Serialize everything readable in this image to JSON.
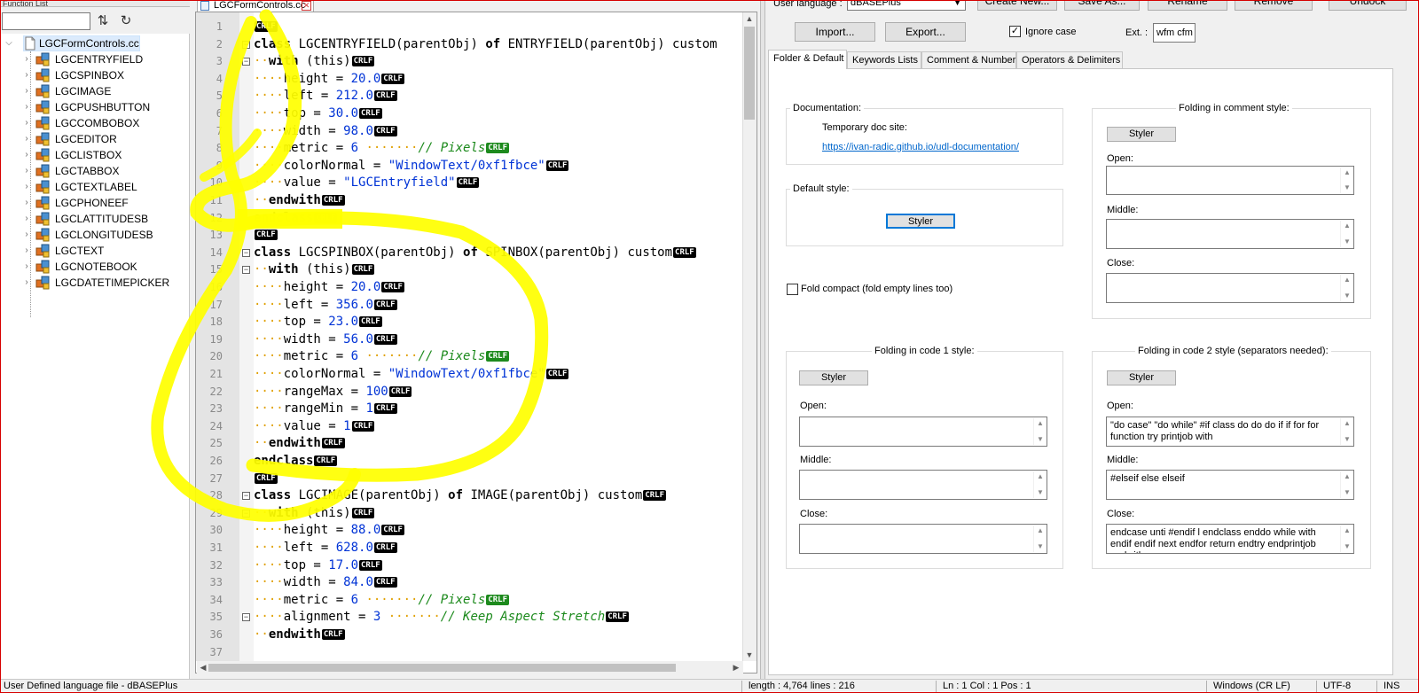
{
  "function_list": {
    "title": "Function List",
    "search_value": "",
    "sort_icon": "sort-az-icon",
    "refresh_icon": "refresh-icon",
    "root": "LGCFormControls.cc",
    "items": [
      "LGCENTRYFIELD",
      "LGCSPINBOX",
      "LGCIMAGE",
      "LGCPUSHBUTTON",
      "LGCCOMBOBOX",
      "LGCEDITOR",
      "LGCLISTBOX",
      "LGCTABBOX",
      "LGCTEXTLABEL",
      "LGCPHONEEF",
      "LGCLATTITUDESB",
      "LGCLONGITUDESB",
      "LGCTEXT",
      "LGCNOTEBOOK",
      "LGCDATETIMEPICKER"
    ]
  },
  "editor": {
    "tab_title": "LGCFormControls.cc",
    "line_numbers": [
      "1",
      "2",
      "3",
      "4",
      "5",
      "6",
      "7",
      "8",
      "9",
      "10",
      "11",
      "12",
      "13",
      "14",
      "15",
      "16",
      "17",
      "18",
      "19",
      "20",
      "21",
      "22",
      "23",
      "24",
      "25",
      "26",
      "27",
      "28",
      "29",
      "30",
      "31",
      "32",
      "33",
      "34",
      "35",
      "36",
      "37"
    ],
    "eol_marker": "CRLF"
  },
  "udl": {
    "user_language_label": "User language :",
    "user_language_value": "dBASEPlus",
    "buttons": {
      "create_new": "Create New...",
      "save_as": "Save As...",
      "rename": "Rename",
      "remove": "Remove",
      "undock": "Undock",
      "import": "Import...",
      "export": "Export..."
    },
    "ignore_case_label": "Ignore case",
    "ignore_case_checked": true,
    "ext_label": "Ext. :",
    "ext_value": "wfm cfm",
    "tabs": [
      "Folder & Default",
      "Keywords Lists",
      "Comment & Number",
      "Operators & Delimiters"
    ],
    "documentation": {
      "title": "Documentation:",
      "temp_label": "Temporary doc site:",
      "link": "https://ivan-radic.github.io/udl-documentation/"
    },
    "default_style": {
      "title": "Default style:",
      "styler": "Styler"
    },
    "fold_compact_label": "Fold compact (fold empty lines too)",
    "fold_compact_checked": false,
    "comment_style": {
      "title": "Folding in comment style:",
      "styler": "Styler",
      "open_label": "Open:",
      "middle_label": "Middle:",
      "close_label": "Close:",
      "open": "",
      "middle": "",
      "close": ""
    },
    "code1_style": {
      "title": "Folding in code 1 style:",
      "styler": "Styler",
      "open_label": "Open:",
      "middle_label": "Middle:",
      "close_label": "Close:",
      "open": "",
      "middle": "",
      "close": ""
    },
    "code2_style": {
      "title": "Folding in code 2 style (separators needed):",
      "styler": "Styler",
      "open_label": "Open:",
      "middle_label": "Middle:",
      "close_label": "Close:",
      "open": "\"do case\" \"do while\" #if class do do do if if for for function try printjob with",
      "middle": "#elseif else elseif",
      "close": "endcase unti #endif l endclass enddo while with endif endif next endfor return endtry endprintjob endwith"
    }
  },
  "status": {
    "file_type": "User Defined language file - dBASEPlus",
    "length": "length : 4,764    lines : 216",
    "position": "Ln : 1    Col : 1    Pos : 1",
    "eol": "Windows (CR LF)",
    "encoding": "UTF-8",
    "mode": "INS"
  },
  "colors": {
    "highlight": "#ffff00",
    "keyword": "#000000",
    "number": "#0033d6",
    "comment": "#1c8a1c",
    "whitespace": "#e0a000"
  }
}
